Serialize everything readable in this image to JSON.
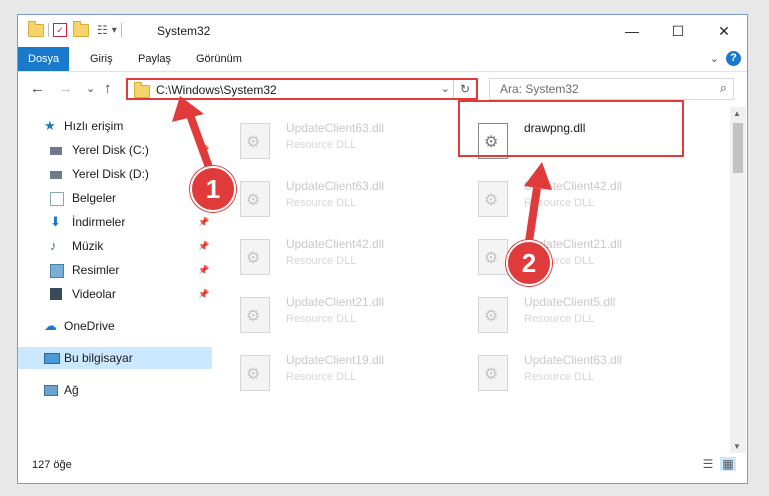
{
  "window": {
    "title": "System32",
    "minimize": "—",
    "maximize": "☐",
    "close": "✕"
  },
  "ribbon": {
    "tabs": [
      "Dosya",
      "Giriş",
      "Paylaş",
      "Görünüm"
    ],
    "collapse": "⌄",
    "help": "?"
  },
  "navigation": {
    "back": "←",
    "forward": "→",
    "recent": "⌄",
    "up": "↑"
  },
  "address": {
    "path": "C:\\Windows\\System32",
    "dropdown": "⌄",
    "refresh": "↻"
  },
  "search": {
    "placeholder": "Ara: System32",
    "icon": "⌕"
  },
  "sidebar": {
    "items": [
      {
        "label": "Hızlı erişim",
        "icon": "star-icon",
        "pinned": false
      },
      {
        "label": "Yerel Disk (C:)",
        "icon": "drive-icon",
        "pinned": true
      },
      {
        "label": "Yerel Disk (D:)",
        "icon": "drive-icon",
        "pinned": true
      },
      {
        "label": "Belgeler",
        "icon": "documents-icon",
        "pinned": true
      },
      {
        "label": "İndirmeler",
        "icon": "downloads-icon",
        "pinned": true
      },
      {
        "label": "Müzik",
        "icon": "music-icon",
        "pinned": true
      },
      {
        "label": "Resimler",
        "icon": "pictures-icon",
        "pinned": true
      },
      {
        "label": "Videolar",
        "icon": "videos-icon",
        "pinned": true
      },
      {
        "label": "OneDrive",
        "icon": "onedrive-icon",
        "pinned": false
      },
      {
        "label": "Bu bilgisayar",
        "icon": "computer-icon",
        "pinned": false
      },
      {
        "label": "Ağ",
        "icon": "network-icon",
        "pinned": false
      }
    ],
    "pin_glyph": "📌"
  },
  "files": {
    "left": [
      {
        "name": "UpdateClient63.dll",
        "type": "Resource DLL"
      },
      {
        "name": "UpdateClient63.dll",
        "type": "Resource DLL"
      },
      {
        "name": "UpdateClient42.dll",
        "type": "Resource DLL"
      },
      {
        "name": "UpdateClient21.dll",
        "type": "Resource DLL"
      },
      {
        "name": "UpdateClient19.dll",
        "type": "Resource DLL"
      }
    ],
    "right": [
      {
        "name": "drawpng.dll",
        "type": ""
      },
      {
        "name": "UpdateClient42.dll",
        "type": "Resource DLL"
      },
      {
        "name": "UpdateClient21.dll",
        "type": "Resource DLL"
      },
      {
        "name": "UpdateClient5.dll",
        "type": "Resource DLL"
      },
      {
        "name": "UpdateClient63.dll",
        "type": "Resource DLL"
      }
    ]
  },
  "status": {
    "item_count": "127 öğe"
  },
  "annotations": {
    "step1": "1",
    "step2": "2"
  },
  "colors": {
    "accent": "#1979ca",
    "highlight": "#e03a3a",
    "selected": "#cce8ff"
  }
}
